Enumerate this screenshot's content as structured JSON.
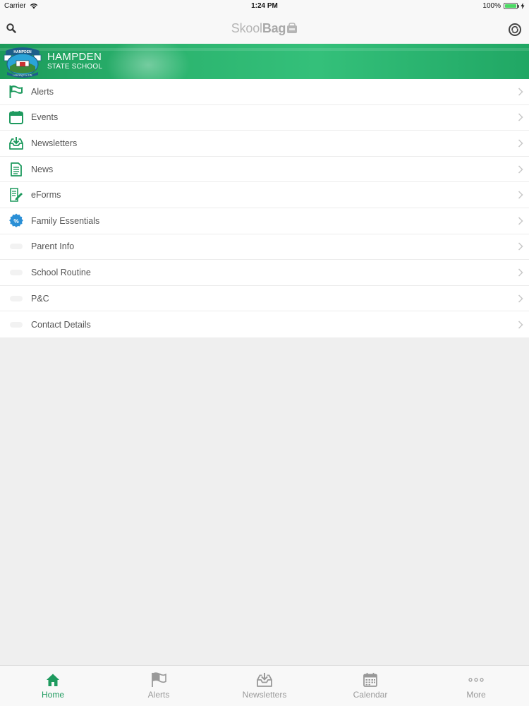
{
  "status_bar": {
    "carrier": "Carrier",
    "time": "1:24 PM",
    "battery": "100%",
    "battery_level": 1.0
  },
  "nav_bar": {
    "brand_part1": "Skool",
    "brand_part2": "Bag",
    "left_icon": "search-icon",
    "right_icon": "refresh-icon"
  },
  "banner": {
    "school_name": "HAMPDEN",
    "school_type": "STATE SCHOOL",
    "logo_text_top": "HAMPDEN",
    "logo_text_bottom": "Learning For Life"
  },
  "menu": {
    "items": [
      {
        "label": "Alerts",
        "icon": "flag-icon"
      },
      {
        "label": "Events",
        "icon": "calendar-icon"
      },
      {
        "label": "Newsletters",
        "icon": "inbox-download-icon"
      },
      {
        "label": "News",
        "icon": "document-icon"
      },
      {
        "label": "eForms",
        "icon": "form-edit-icon"
      },
      {
        "label": "Family Essentials",
        "icon": "percent-badge-icon"
      },
      {
        "label": "Parent Info",
        "icon": "placeholder-icon"
      },
      {
        "label": "School Routine",
        "icon": "placeholder-icon"
      },
      {
        "label": "P&C",
        "icon": "placeholder-icon"
      },
      {
        "label": "Contact Details",
        "icon": "placeholder-icon"
      }
    ]
  },
  "tab_bar": {
    "tabs": [
      {
        "label": "Home",
        "icon": "home-icon",
        "active": true
      },
      {
        "label": "Alerts",
        "icon": "flag-icon",
        "active": false
      },
      {
        "label": "Newsletters",
        "icon": "inbox-download-icon",
        "active": false
      },
      {
        "label": "Calendar",
        "icon": "calendar-icon",
        "active": false
      },
      {
        "label": "More",
        "icon": "more-dots-icon",
        "active": false
      }
    ]
  },
  "colors": {
    "accent_green": "#1e9a5e",
    "banner_green": "#2bb36e",
    "badge_blue": "#2a8fd6",
    "inactive_gray": "#999999"
  }
}
